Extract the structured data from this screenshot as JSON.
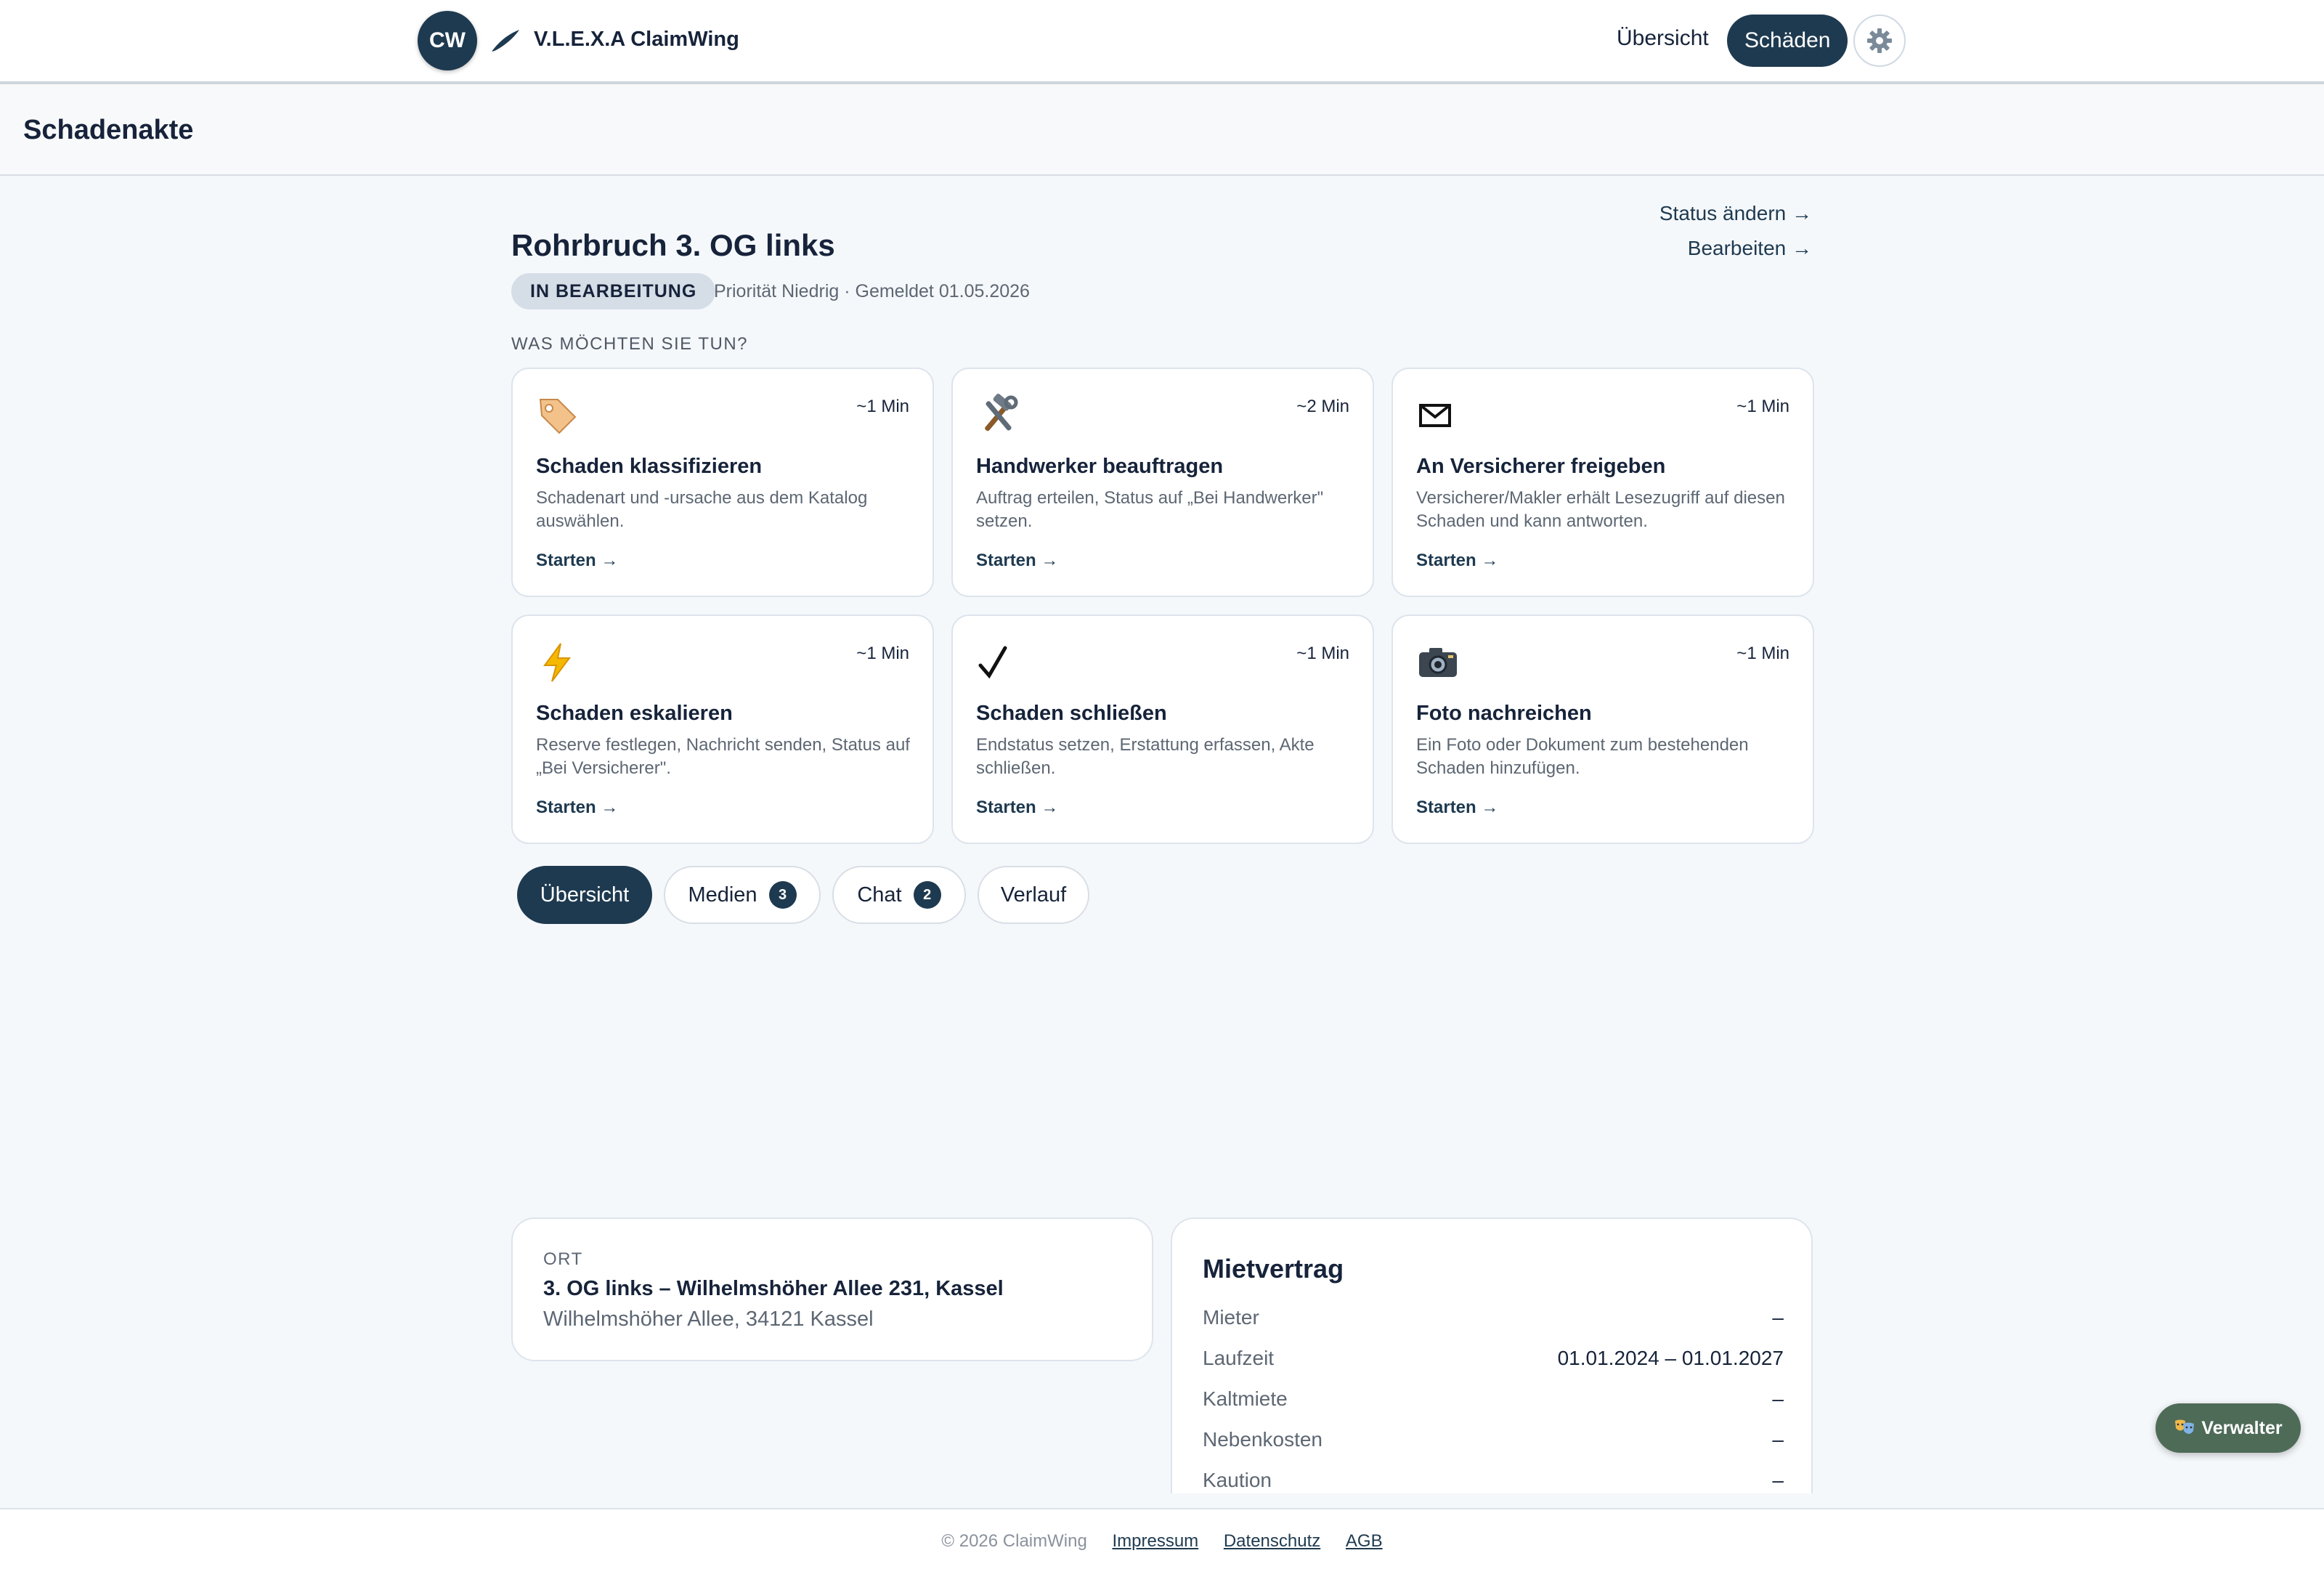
{
  "topbar": {
    "logo_initials": "CW",
    "brand_name": "V.L.E.X.A ClaimWing",
    "nav": {
      "overview_label": "Übersicht",
      "claims_label": "Schäden"
    },
    "settings_icon": "gear-icon"
  },
  "page": {
    "title": "Schadenakte"
  },
  "claim": {
    "title": "Rohrbruch 3. OG links",
    "status": "IN BEARBEITUNG",
    "meta": "Priorität Niedrig · Gemeldet 01.05.2026",
    "actions": {
      "change_status": "Status ändern →",
      "edit": "Bearbeiten →"
    }
  },
  "actions_section": {
    "label": "WAS MÖCHTEN SIE TUN?",
    "cards": [
      {
        "icon": "tag-icon",
        "time": "~1 Min",
        "title": "Schaden klassifizieren",
        "desc": "Schadenart und -ursache aus dem Katalog auswählen.",
        "start": "Starten →"
      },
      {
        "icon": "tools-icon",
        "time": "~2 Min",
        "title": "Handwerker beauftragen",
        "desc": "Auftrag erteilen, Status auf „Bei Handwerker\" setzen.",
        "start": "Starten →"
      },
      {
        "icon": "envelope-icon",
        "time": "~1 Min",
        "title": "An Versicherer freigeben",
        "desc": "Versicherer/Makler erhält Lesezugriff auf diesen Schaden und kann antworten.",
        "start": "Starten →"
      },
      {
        "icon": "lightning-icon",
        "time": "~1 Min",
        "title": "Schaden eskalieren",
        "desc": "Reserve festlegen, Nachricht senden, Status auf „Bei Versicherer\".",
        "start": "Starten →"
      },
      {
        "icon": "checkmark-icon",
        "time": "~1 Min",
        "title": "Schaden schließen",
        "desc": "Endstatus setzen, Erstattung erfassen, Akte schließen.",
        "start": "Starten →"
      },
      {
        "icon": "camera-icon",
        "time": "~1 Min",
        "title": "Foto nachreichen",
        "desc": "Ein Foto oder Dokument zum bestehenden Schaden hinzufügen.",
        "start": "Starten →"
      }
    ]
  },
  "tabs": [
    {
      "label": "Übersicht",
      "active": true
    },
    {
      "label": "Medien",
      "count": "3"
    },
    {
      "label": "Chat",
      "count": "2"
    },
    {
      "label": "Verlauf"
    }
  ],
  "location": {
    "label": "ORT",
    "title": "3. OG links – Wilhelmshöher Allee 231, Kassel",
    "address": "Wilhelmshöher Allee, 34121 Kassel"
  },
  "contract": {
    "title": "Mietvertrag",
    "rows": [
      {
        "key": "Mieter",
        "value": "–"
      },
      {
        "key": "Laufzeit",
        "value": "01.01.2024 – 01.01.2027"
      },
      {
        "key": "Kaltmiete",
        "value": "–"
      },
      {
        "key": "Nebenkosten",
        "value": "–"
      },
      {
        "key": "Kaution",
        "value": "–"
      }
    ]
  },
  "role_button": {
    "icon": "theater-masks-icon",
    "label": "Verwalter"
  },
  "footer": {
    "copyright": "© 2026 ClaimWing",
    "links": [
      "Impressum",
      "Datenschutz",
      "AGB"
    ]
  },
  "colors": {
    "primary": "#1e3a50",
    "role_button": "#4e6b58",
    "page_bg": "#f5f8fb"
  }
}
